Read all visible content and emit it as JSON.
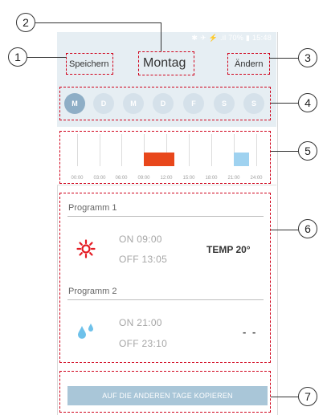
{
  "statusbar": {
    "text": "✱ ✈ ⚡ .il 70% ▮ 15:48"
  },
  "header": {
    "save_label": "Speichern",
    "title": "Montag",
    "edit_label": "Ändern"
  },
  "days": [
    {
      "label": "M",
      "active": true
    },
    {
      "label": "D",
      "active": false
    },
    {
      "label": "M",
      "active": false
    },
    {
      "label": "D",
      "active": false
    },
    {
      "label": "F",
      "active": false
    },
    {
      "label": "S",
      "active": false
    },
    {
      "label": "S",
      "active": false
    }
  ],
  "timeline": {
    "labels": [
      "00:00",
      "03:00",
      "06:00",
      "09:00",
      "12:00",
      "15:00",
      "18:00",
      "21:00",
      "24:00"
    ],
    "colors": {
      "heat": "#e8471b",
      "water": "#9fd2f0"
    }
  },
  "programs": [
    {
      "title": "Programm 1",
      "on": "ON 09:00",
      "off": "OFF 13:05",
      "value": "TEMP 20°",
      "icon": "sun-icon"
    },
    {
      "title": "Programm 2",
      "on": "ON 21:00",
      "off": "OFF 23:10",
      "value": "- -",
      "icon": "water-drops-icon"
    }
  ],
  "copy_button": "AUF DIE ANDEREN TAGE KOPIEREN",
  "callouts": [
    "1",
    "2",
    "3",
    "4",
    "5",
    "6",
    "7"
  ]
}
